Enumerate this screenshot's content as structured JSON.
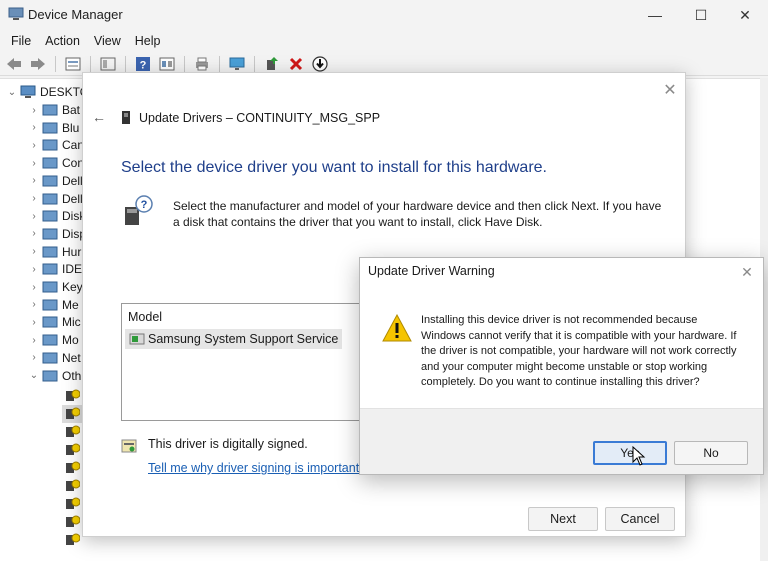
{
  "window": {
    "title": "Device Manager",
    "controls": {
      "minimize": "—",
      "maximize": "☐",
      "close": "✕"
    }
  },
  "menubar": [
    "File",
    "Action",
    "View",
    "Help"
  ],
  "toolbar": {
    "icons": [
      "back-arrow-icon",
      "forward-arrow-icon",
      "properties-icon",
      "list-view-icon",
      "help-icon",
      "resources-view-icon",
      "print-icon",
      "monitor-icon",
      "update-driver-icon",
      "uninstall-icon",
      "download-icon"
    ]
  },
  "tree": {
    "root": "DESKTO",
    "items": [
      {
        "label": "Bat",
        "icon": "battery-icon"
      },
      {
        "label": "Blu",
        "icon": "bluetooth-icon"
      },
      {
        "label": "Can",
        "icon": "camera-icon"
      },
      {
        "label": "Con",
        "icon": "computer-icon"
      },
      {
        "label": "Dell",
        "icon": "monitor-icon"
      },
      {
        "label": "Dell",
        "icon": "monitor-icon"
      },
      {
        "label": "Disk",
        "icon": "disk-icon"
      },
      {
        "label": "Disp",
        "icon": "display-icon"
      },
      {
        "label": "Hur",
        "icon": "hid-icon"
      },
      {
        "label": "IDE",
        "icon": "ide-icon"
      },
      {
        "label": "Key",
        "icon": "keyboard-icon"
      },
      {
        "label": "Me",
        "icon": "memory-icon"
      },
      {
        "label": "Mic",
        "icon": "mouse-icon"
      },
      {
        "label": "Mo",
        "icon": "monitor-icon"
      },
      {
        "label": "Net",
        "icon": "network-icon"
      },
      {
        "label": "Oth",
        "icon": "other-devices-icon"
      }
    ]
  },
  "wizard": {
    "title": "Update Drivers – CONTINUITY_MSG_SPP",
    "heading": "Select the device driver you want to install for this hardware.",
    "description": "Select the manufacturer and model of your hardware device and then click Next. If you have a disk that contains the driver that you want to install, click Have Disk.",
    "model_header": "Model",
    "model_item": "Samsung System Support Service",
    "signed_text": "This driver is digitally signed.",
    "signed_link": "Tell me why driver signing is important",
    "next_label": "Next",
    "cancel_label": "Cancel",
    "close_symbol": "✕",
    "back_symbol": "←"
  },
  "warning": {
    "title": "Update Driver Warning",
    "message": "Installing this device driver is not recommended because Windows cannot verify that it is compatible with your hardware.  If the driver is not compatible, your hardware will not work correctly and your computer might become unstable or stop working completely.  Do you want to continue installing this driver?",
    "yes_label": "Yes",
    "no_label": "No",
    "close_symbol": "✕"
  },
  "colors": {
    "heading_blue": "#1f3f8a",
    "link_blue": "#1a5fb4",
    "warning_yellow": "#f5c400",
    "focus_blue": "#3a7bd5"
  }
}
